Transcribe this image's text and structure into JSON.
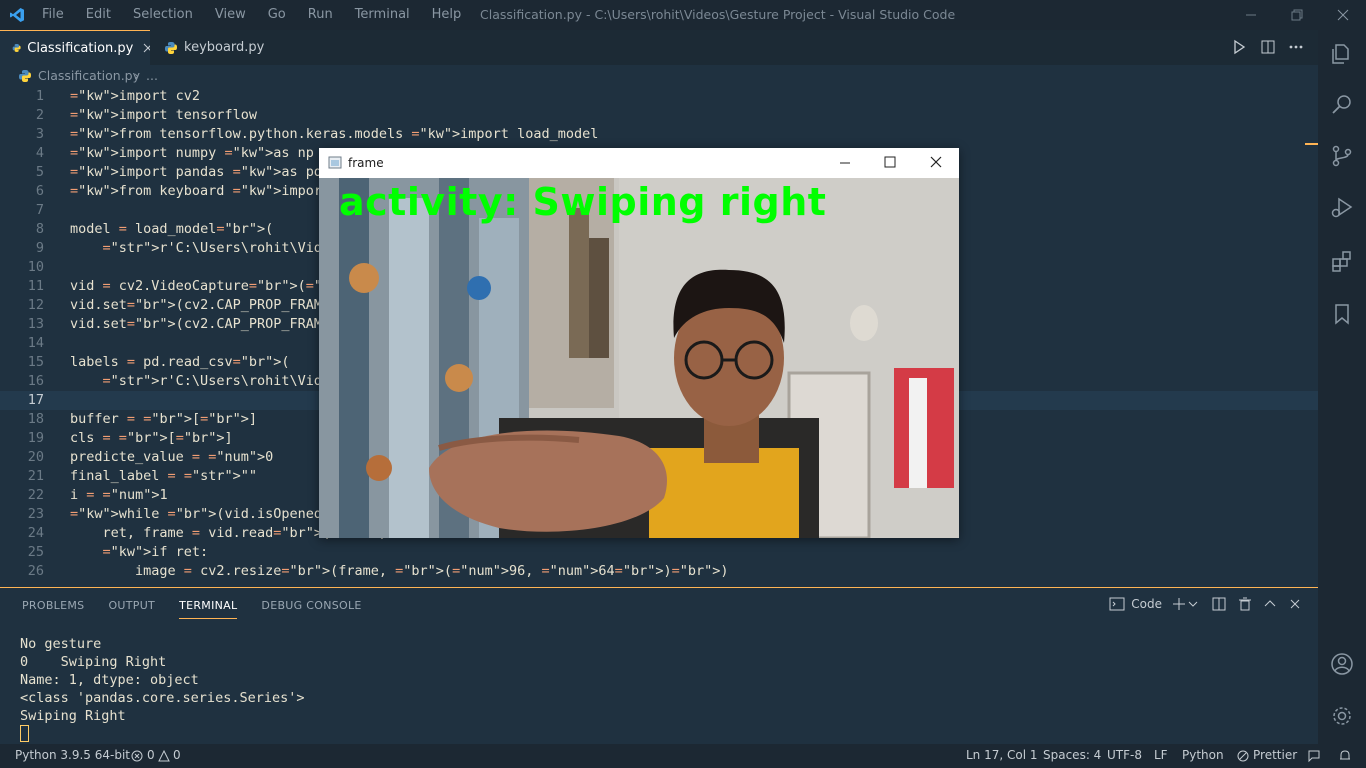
{
  "window": {
    "title": "Classification.py - C:\\Users\\rohit\\Videos\\Gesture Project - Visual Studio Code",
    "menu": [
      "File",
      "Edit",
      "Selection",
      "View",
      "Go",
      "Run",
      "Terminal",
      "Help"
    ]
  },
  "tabs": [
    {
      "label": "Classification.py",
      "active": true
    },
    {
      "label": "keyboard.py",
      "active": false
    }
  ],
  "breadcrumb": {
    "file": "Classification.py",
    "rest": "..."
  },
  "code_lines": [
    "import cv2",
    "import tensorflow",
    "from tensorflow.python.keras.models import load_model",
    "import numpy as np",
    "import pandas as pd",
    "from keyboard import Keyboard",
    "",
    "model = load_model(",
    "    r'C:\\Users\\rohit\\Videos\\Ge",
    "",
    "vid = cv2.VideoCapture(0)",
    "vid.set(cv2.CAP_PROP_FRAME_WID",
    "vid.set(cv2.CAP_PROP_FRAME_HEI",
    "",
    "labels = pd.read_csv(",
    "    r'C:\\Users\\rohit\\Videos\\Ge",
    "",
    "buffer = []",
    "cls = []",
    "predicte_value = 0",
    "final_label = \"\"",
    "i = 1",
    "while (vid.isOpened()):",
    "    ret, frame = vid.read()",
    "    if ret:",
    "        image = cv2.resize(frame, (96, 64))"
  ],
  "panel": {
    "tabs": [
      "PROBLEMS",
      "OUTPUT",
      "TERMINAL",
      "DEBUG CONSOLE"
    ],
    "active_tab": "TERMINAL",
    "terminal_name": "Code",
    "terminal_lines": [
      "No gesture",
      "0    Swiping Right",
      "Name: 1, dtype: object",
      "<class 'pandas.core.series.Series'>",
      "Swiping Right"
    ]
  },
  "frame_window": {
    "title": "frame",
    "overlay": "activity: Swiping right"
  },
  "status": {
    "python": "Python 3.9.5 64-bit",
    "errors": "0",
    "warnings": "0",
    "position": "Ln 17, Col 1",
    "spaces": "Spaces: 4",
    "encoding": "UTF-8",
    "eol": "LF",
    "language": "Python",
    "prettier": "Prettier"
  },
  "colors": {
    "accent": "#ffb454",
    "overlay_text": "#00ff00"
  }
}
